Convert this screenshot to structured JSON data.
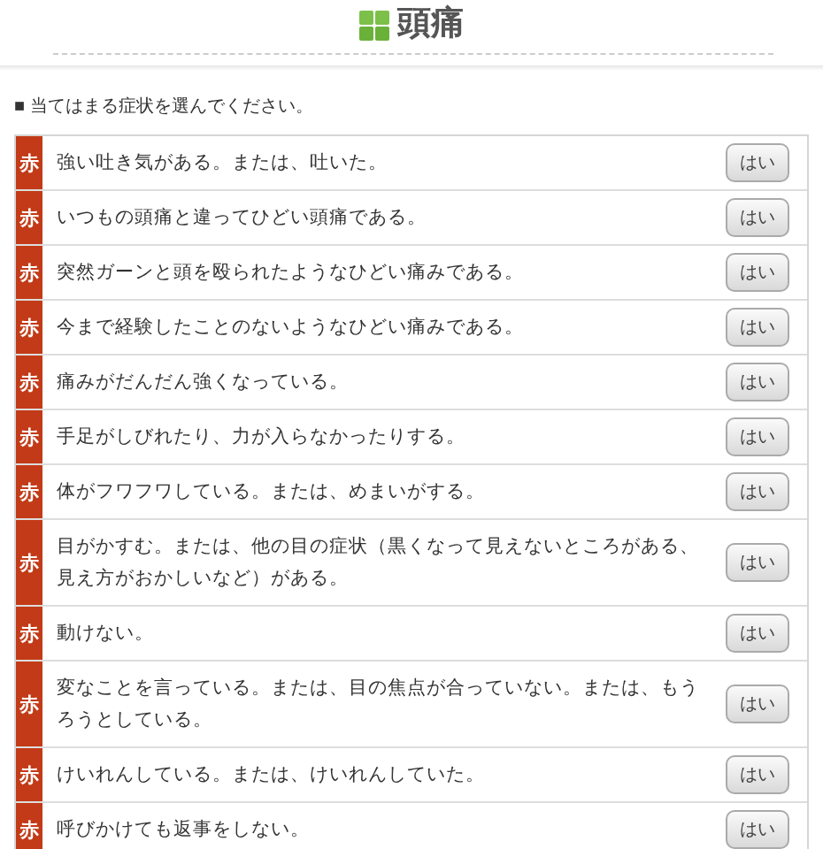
{
  "title": "頭痛",
  "instruction": "■ 当てはまる症状を選んでください。",
  "symptoms": [
    {
      "tag": "赤",
      "text": "強い吐き気がある。または、吐いた。",
      "button": "はい"
    },
    {
      "tag": "赤",
      "text": "いつもの頭痛と違ってひどい頭痛である。",
      "button": "はい"
    },
    {
      "tag": "赤",
      "text": "突然ガーンと頭を殴られたようなひどい痛みである。",
      "button": "はい"
    },
    {
      "tag": "赤",
      "text": "今まで経験したことのないようなひどい痛みである。",
      "button": "はい"
    },
    {
      "tag": "赤",
      "text": "痛みがだんだん強くなっている。",
      "button": "はい"
    },
    {
      "tag": "赤",
      "text": "手足がしびれたり、力が入らなかったりする。",
      "button": "はい"
    },
    {
      "tag": "赤",
      "text": "体がフワフワしている。または、めまいがする。",
      "button": "はい"
    },
    {
      "tag": "赤",
      "text": "目がかすむ。または、他の目の症状（黒くなって見えないところがある、見え方がおかしいなど）がある。",
      "button": "はい"
    },
    {
      "tag": "赤",
      "text": "動けない。",
      "button": "はい"
    },
    {
      "tag": "赤",
      "text": "変なことを言っている。または、目の焦点が合っていない。または、もうろうとしている。",
      "button": "はい"
    },
    {
      "tag": "赤",
      "text": "けいれんしている。または、けいれんしていた。",
      "button": "はい"
    },
    {
      "tag": "赤",
      "text": "呼びかけても返事をしない。",
      "button": "はい"
    }
  ]
}
